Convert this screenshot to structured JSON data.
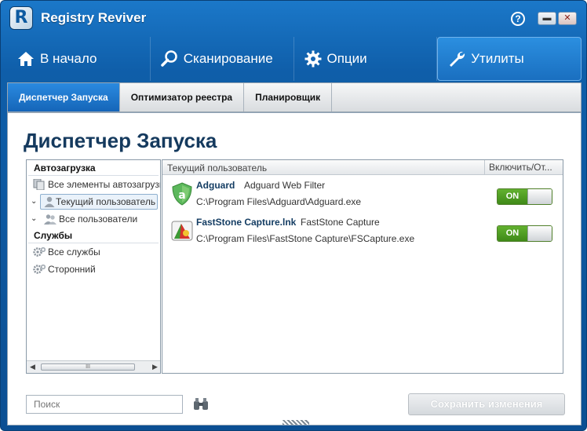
{
  "window": {
    "title": "Registry Reviver",
    "logo_letter": "R",
    "help_label": "?",
    "minimize_label": "▬",
    "close_label": "✕"
  },
  "nav": {
    "items": [
      {
        "label": "В начало",
        "icon": "home-icon"
      },
      {
        "label": "Сканирование",
        "icon": "search-icon"
      },
      {
        "label": "Опции",
        "icon": "gear-icon"
      },
      {
        "label": "Утилиты",
        "icon": "wrench-icon",
        "active": true
      }
    ]
  },
  "subtabs": [
    {
      "label": "Диспетчер Запуска",
      "active": true
    },
    {
      "label": "Оптимизатор реестра"
    },
    {
      "label": "Планировщик"
    }
  ],
  "page": {
    "title": "Диспетчер Запуска"
  },
  "tree": {
    "group_autoload": "Автозагрузка",
    "all_items": "Все элементы автозагрузк",
    "current_user": "Текущий пользователь",
    "all_users": "Все пользователи",
    "group_services": "Службы",
    "all_services": "Все службы",
    "third_party": "Сторонний",
    "scroll_thumb_mark": "III"
  },
  "list": {
    "col_user": "Текущий пользователь",
    "col_enable": "Включить/От...",
    "entries": [
      {
        "name": "Adguard",
        "description": "Adguard Web Filter",
        "path": "C:\\Program Files\\Adguard\\Adguard.exe",
        "toggle": "ON",
        "icon": "adguard-shield-icon"
      },
      {
        "name": "FastStone Capture.lnk",
        "description": "FastStone Capture",
        "path": "C:\\Program Files\\FastStone Capture\\FSCapture.exe",
        "toggle": "ON",
        "icon": "faststone-capture-icon"
      }
    ]
  },
  "bottom": {
    "search_placeholder": "Поиск",
    "save_label": "Сохранить изменения"
  },
  "colors": {
    "frame_blue": "#0f5ea9",
    "active_tab": "#1a75cc",
    "toggle_green": "#4f9a22",
    "title_text": "#153a5e"
  }
}
